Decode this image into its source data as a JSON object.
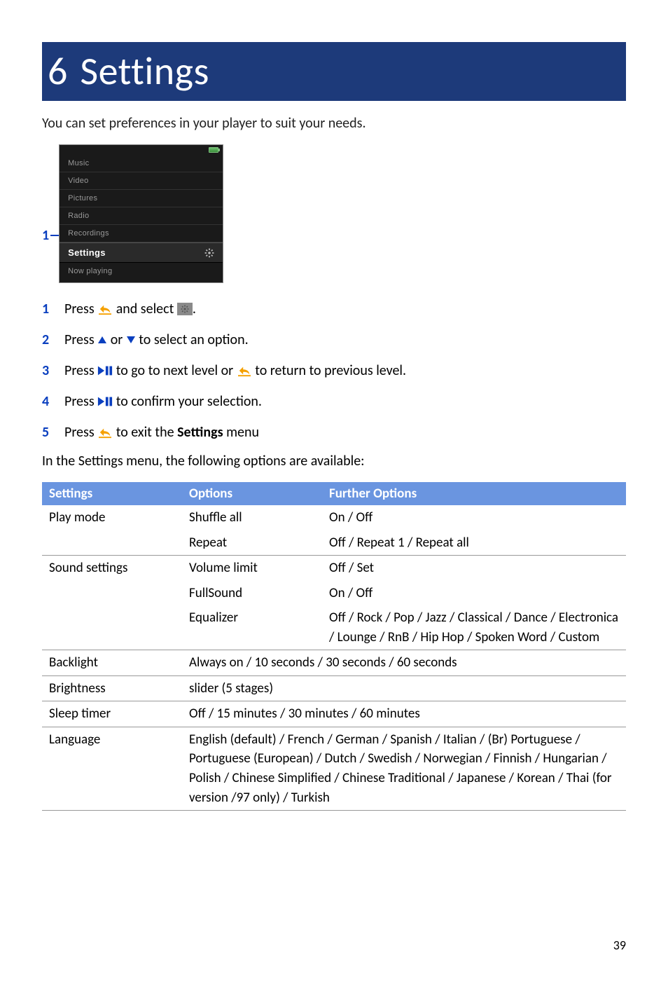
{
  "header": {
    "num": "6",
    "title": "Settings"
  },
  "intro": "You can set preferences in your player to suit your needs.",
  "callout_num": "1",
  "device_menu": {
    "items": [
      "Music",
      "Video",
      "Pictures",
      "Radio",
      "Recordings",
      "Settings",
      "Now playing"
    ],
    "selected_index": 5
  },
  "steps": [
    {
      "n": "1",
      "pre": "Press ",
      "icon1": "back",
      "mid": " and select ",
      "icon2": "gear",
      "post": "."
    },
    {
      "n": "2",
      "pre": "Press ",
      "icon1": "tri-up",
      "mid": " or ",
      "icon2": "tri-down",
      "post": " to select an option."
    },
    {
      "n": "3",
      "pre": "Press ",
      "icon1": "playpause",
      "mid": " to go to next level or ",
      "icon2": "back",
      "post": " to return to previous level."
    },
    {
      "n": "4",
      "pre": "Press ",
      "icon1": "playpause",
      "mid": "",
      "icon2": null,
      "post": " to confirm your selection."
    },
    {
      "n": "5",
      "pre": "Press ",
      "icon1": "back",
      "mid": " to exit the ",
      "bold": "Settings",
      "post": " menu"
    }
  ],
  "after_steps": "In the Settings menu, the following options are available:",
  "table": {
    "headers": [
      "Settings",
      "Options",
      "Further Options"
    ],
    "rows": [
      {
        "rule": false,
        "c1": "Play mode",
        "c2": "Shuffle all",
        "c3": "On / Off"
      },
      {
        "rule": true,
        "c1": "",
        "c2": "Repeat",
        "c3": "Off / Repeat 1 / Repeat all"
      },
      {
        "rule": false,
        "c1": "Sound settings",
        "c2": "Volume limit",
        "c3": "Off / Set"
      },
      {
        "rule": false,
        "c1": "",
        "c2": "FullSound",
        "c3": "On / Off"
      },
      {
        "rule": true,
        "c1": "",
        "c2": "Equalizer",
        "c3": "Off / Rock / Pop / Jazz / Classical / Dance / Electronica / Lounge / RnB / Hip Hop / Spoken Word / Custom"
      },
      {
        "rule": true,
        "c1": "Backlight",
        "c2span": "Always on / 10 seconds / 30 seconds / 60 seconds"
      },
      {
        "rule": true,
        "c1": "Brightness",
        "c2span": "slider (5 stages)"
      },
      {
        "rule": true,
        "c1": "Sleep timer",
        "c2span": "Off / 15 minutes / 30 minutes / 60 minutes"
      },
      {
        "rule": true,
        "c1": "Language",
        "c2span": "English (default) / French / German / Spanish / Italian / (Br) Portuguese / Portuguese (European) / Dutch / Swedish / Norwegian / Finnish / Hungarian / Polish / Chinese Simplified / Chinese Traditional / Japanese / Korean / Thai (for version /97 only) / Turkish"
      }
    ]
  },
  "page_number": "39"
}
